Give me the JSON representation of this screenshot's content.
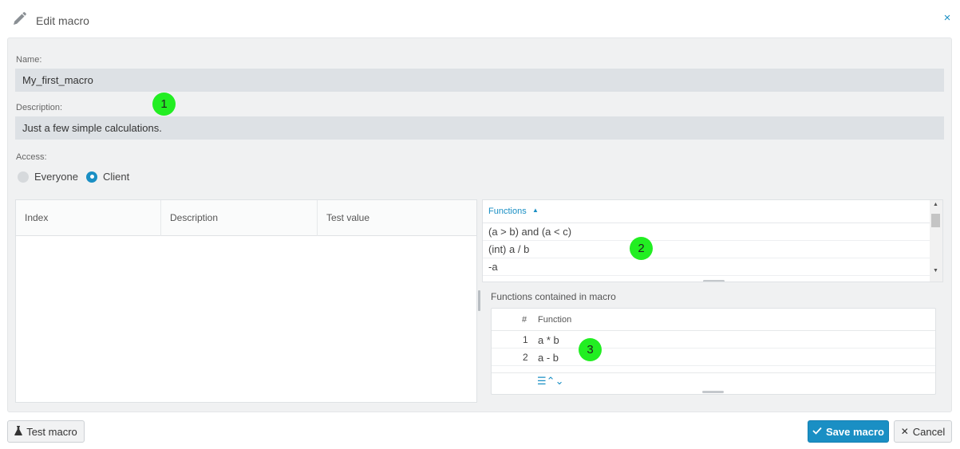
{
  "header": {
    "title": "Edit macro",
    "icon": "pencil-icon",
    "close_icon": "close-icon",
    "close_glyph": "×"
  },
  "form": {
    "name_label": "Name:",
    "name_value": "My_first_macro",
    "description_label": "Description:",
    "description_value": "Just a few simple calculations.",
    "access_label": "Access:",
    "access_options": [
      {
        "label": "Everyone",
        "selected": false
      },
      {
        "label": "Client",
        "selected": true
      }
    ]
  },
  "parameters_table": {
    "columns": [
      "Index",
      "Description",
      "Test value"
    ],
    "rows": []
  },
  "functions_list": {
    "header": "Functions",
    "sort_direction": "ascending",
    "items": [
      "(a > b) and (a < c)",
      "(int) a / b",
      "-a"
    ]
  },
  "contained": {
    "label": "Functions contained in macro",
    "columns": [
      "#",
      "Function"
    ],
    "rows": [
      {
        "index": "1",
        "function": "a * b"
      },
      {
        "index": "2",
        "function": "a - b"
      }
    ]
  },
  "markers": [
    "1",
    "2",
    "3"
  ],
  "buttons": {
    "test_label": "Test macro",
    "save_label": "Save macro",
    "cancel_label": "Cancel"
  },
  "colors": {
    "accent": "#1a8fc4",
    "marker": "#22ee22",
    "panel_bg": "#f0f1f2",
    "field_bg": "#dde1e5"
  }
}
